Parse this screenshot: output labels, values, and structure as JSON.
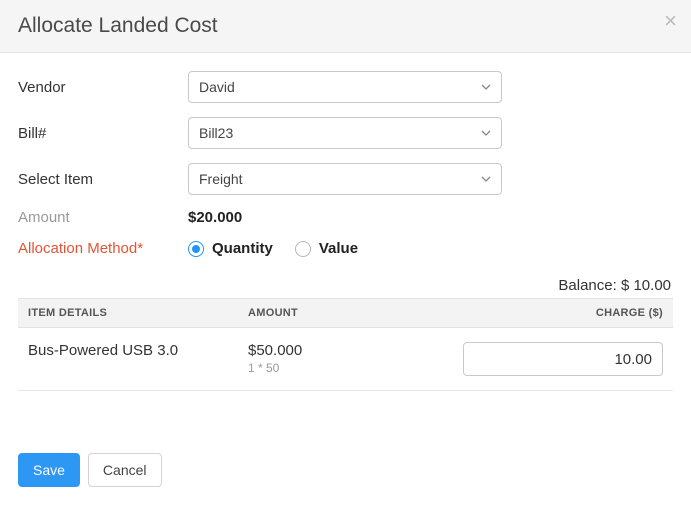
{
  "header": {
    "title": "Allocate Landed Cost"
  },
  "form": {
    "vendor_label": "Vendor",
    "vendor_value": "David",
    "bill_label": "Bill#",
    "bill_value": "Bill23",
    "item_label": "Select Item",
    "item_value": "Freight",
    "amount_label": "Amount",
    "amount_value": "$20.000",
    "method_label": "Allocation Method*",
    "method_options": {
      "quantity": "Quantity",
      "value": "Value"
    }
  },
  "balance": {
    "label": "Balance:",
    "value": "$ 10.00"
  },
  "table": {
    "headers": {
      "item": "ITEM DETAILS",
      "amount": "AMOUNT",
      "charge": "CHARGE ($)"
    },
    "rows": [
      {
        "item": "Bus-Powered USB 3.0",
        "amount": "$50.000",
        "detail": "1 * 50",
        "charge": "10.00"
      }
    ]
  },
  "footer": {
    "save": "Save",
    "cancel": "Cancel"
  }
}
